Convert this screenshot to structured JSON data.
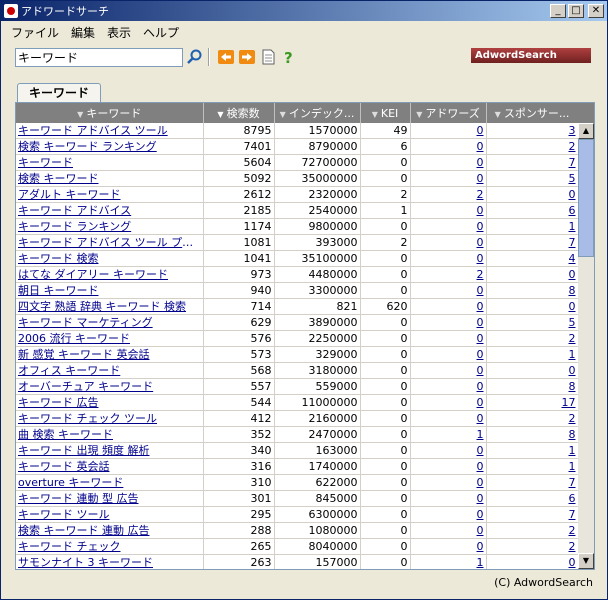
{
  "window": {
    "title": "アドワードサーチ"
  },
  "menu": [
    "ファイル",
    "編集",
    "表示",
    "ヘルプ"
  ],
  "search": {
    "value": "キーワード"
  },
  "brand": "AdwordSearch",
  "tab": "キーワード",
  "columns": [
    "キーワード",
    "検索数",
    "インデック...",
    "KEI",
    "アドワーズ",
    "スポンサー..."
  ],
  "rows": [
    [
      "キーワード アドバイス ツール",
      "8795",
      "1570000",
      "49",
      "0",
      "3"
    ],
    [
      "検索 キーワード ランキング",
      "7401",
      "8790000",
      "6",
      "0",
      "2"
    ],
    [
      "キーワード",
      "5604",
      "72700000",
      "0",
      "0",
      "7"
    ],
    [
      "検索 キーワード",
      "5092",
      "35000000",
      "0",
      "0",
      "5"
    ],
    [
      "アダルト キーワード",
      "2612",
      "2320000",
      "2",
      "2",
      "0"
    ],
    [
      "キーワード アドバイス",
      "2185",
      "2540000",
      "1",
      "0",
      "6"
    ],
    [
      "キーワード ランキング",
      "1174",
      "9800000",
      "0",
      "0",
      "1"
    ],
    [
      "キーワード アドバイス ツール プラス",
      "1081",
      "393000",
      "2",
      "0",
      "7"
    ],
    [
      "キーワード 検索",
      "1041",
      "35100000",
      "0",
      "0",
      "4"
    ],
    [
      "はてな ダイアリー キーワード",
      "973",
      "4480000",
      "0",
      "2",
      "0"
    ],
    [
      "朝日 キーワード",
      "940",
      "3300000",
      "0",
      "0",
      "8"
    ],
    [
      "四文字 熟語 辞典 キーワード 検索",
      "714",
      "821",
      "620",
      "0",
      "0"
    ],
    [
      "キーワード マーケティング",
      "629",
      "3890000",
      "0",
      "0",
      "5"
    ],
    [
      "2006 流行 キーワード",
      "576",
      "2250000",
      "0",
      "0",
      "2"
    ],
    [
      "新 感覚 キーワード 英会話",
      "573",
      "329000",
      "0",
      "0",
      "1"
    ],
    [
      "オフィス キーワード",
      "568",
      "3180000",
      "0",
      "0",
      "0"
    ],
    [
      "オーバーチュア キーワード",
      "557",
      "559000",
      "0",
      "0",
      "8"
    ],
    [
      "キーワード 広告",
      "544",
      "11000000",
      "0",
      "0",
      "17"
    ],
    [
      "キーワード チェック ツール",
      "412",
      "2160000",
      "0",
      "0",
      "2"
    ],
    [
      "曲 検索 キーワード",
      "352",
      "2470000",
      "0",
      "1",
      "8"
    ],
    [
      "キーワード 出現 頻度 解析",
      "340",
      "163000",
      "0",
      "0",
      "1"
    ],
    [
      "キーワード 英会話",
      "316",
      "1740000",
      "0",
      "0",
      "1"
    ],
    [
      "overture キーワード",
      "310",
      "622000",
      "0",
      "0",
      "7"
    ],
    [
      "キーワード 連動 型 広告",
      "301",
      "845000",
      "0",
      "0",
      "6"
    ],
    [
      "キーワード ツール",
      "295",
      "6300000",
      "0",
      "0",
      "7"
    ],
    [
      "検索 キーワード 連動 広告",
      "288",
      "1080000",
      "0",
      "0",
      "2"
    ],
    [
      "キーワード チェック",
      "265",
      "8040000",
      "0",
      "0",
      "2"
    ],
    [
      "サモンナイト 3 キーワード",
      "263",
      "157000",
      "0",
      "1",
      "0"
    ]
  ],
  "footer": "(C) AdwordSearch"
}
